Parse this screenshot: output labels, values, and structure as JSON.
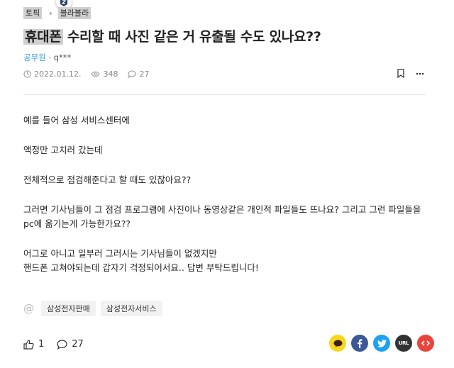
{
  "breadcrumb": {
    "topic": "토픽",
    "category": "블라블라"
  },
  "post": {
    "title_highlight": "휴대폰",
    "title_rest": " 수리할 때 사진 같은 거 유출될 수도 있나요??",
    "author_org": "공무원",
    "author_sep": " · ",
    "author_name": "q***",
    "date": "2022.01.12.",
    "views": "348",
    "comments": "27",
    "paragraphs": [
      "예를 들어 삼성 서비스센터에",
      "액정만 고치러 갔는데",
      "전체적으로 점검해준다고 할 때도 있잖아요??",
      "그러면 기사님들이 그 점검 프로그램에 사진이나 동영상같은 개인적 파일들도 뜨나요? 그리고 그런 파일들을 pc에 옮기는게 가능한가요??",
      "어그로 아니고 일부러 그러시는 기사님들이 없겠지만",
      "핸드폰 고쳐야되는데 갑자기 걱정되어서요.. 답변 부탁드립니다!"
    ],
    "tags": [
      "삼성전자판매",
      "삼성전자서비스"
    ],
    "likes": "1",
    "comment_count": "27"
  },
  "share": {
    "url_label": "URL"
  },
  "colors": {
    "kakao": "#f9d71c",
    "facebook": "#3b5998",
    "twitter": "#1da1f2",
    "url": "#333333",
    "link": "#e8453c",
    "highlight": "#cfcfcf",
    "org": "#3a9bd9"
  },
  "icons": [
    "clock-icon",
    "eye-icon",
    "comment-icon",
    "bookmark-icon",
    "more-icon",
    "thumbs-up-icon",
    "kakao-icon",
    "facebook-icon",
    "twitter-icon",
    "url-icon",
    "share-link-icon",
    "at-icon"
  ]
}
